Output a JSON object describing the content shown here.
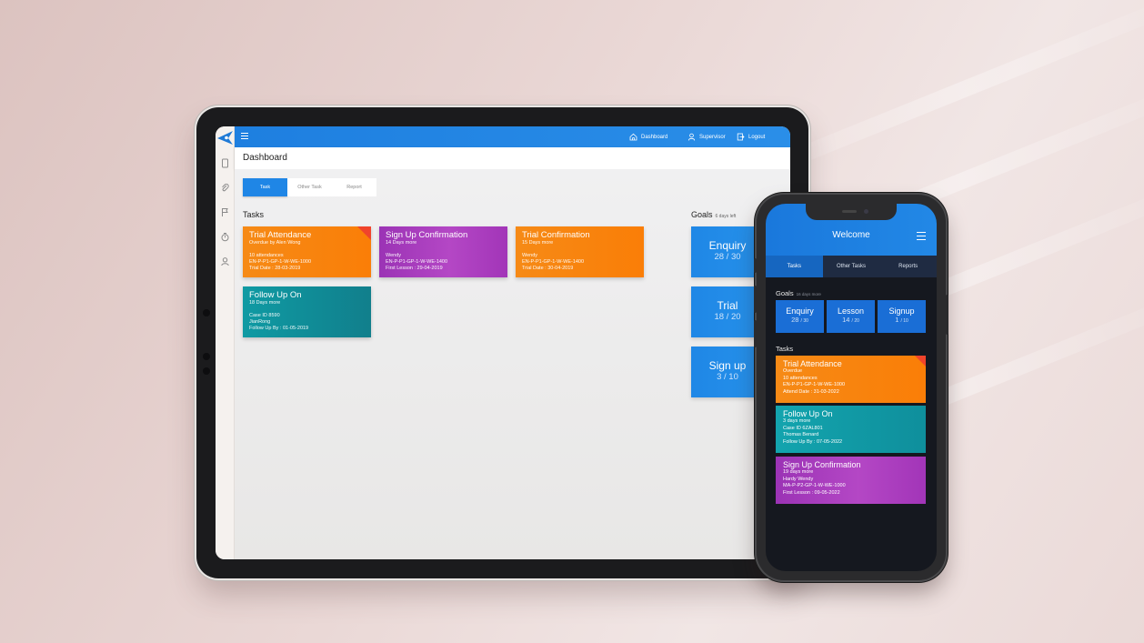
{
  "tablet": {
    "header": {
      "nav": [
        {
          "label": "Dashboard",
          "icon": "home-icon"
        },
        {
          "label": "Supervisor",
          "icon": "user-icon"
        },
        {
          "label": "Logout",
          "icon": "logout-icon"
        }
      ]
    },
    "sidebar": {
      "icons": [
        "tablet-icon",
        "paperclip-icon",
        "flag-icon",
        "timer-icon",
        "user-icon"
      ]
    },
    "page_title": "Dashboard",
    "tabs": [
      {
        "label": "Task",
        "active": true
      },
      {
        "label": "Other Task",
        "active": false
      },
      {
        "label": "Report",
        "active": false
      }
    ],
    "tasks_heading": "Tasks",
    "tasks": [
      {
        "title": "Trial Attendance",
        "subtitle": "Overdue by Alen Wong",
        "lines": [
          "10 attendances",
          "EN-P-P1-GP-1-W-WE-1000",
          "Trial Date : 28-03-2019"
        ],
        "color": "orange",
        "flag": true
      },
      {
        "title": "Sign Up Confirmation",
        "subtitle": "14 Days more",
        "lines": [
          "Wendy",
          "EN-P-P1-GP-1-W-WE-1400",
          "First Lesson : 29-04-2019"
        ],
        "color": "purple",
        "flag": false
      },
      {
        "title": "Trial Confirmation",
        "subtitle": "15 Days more",
        "lines": [
          "Wendy",
          "EN-P-P1-GP-1-W-WE-1400",
          "Trial Date : 30-04-2019"
        ],
        "color": "orange",
        "flag": false
      },
      {
        "title": "Follow Up On",
        "subtitle": "18 Days more",
        "lines": [
          "Case ID 8590",
          "JianRong",
          "Follow Up By : 01-05-2019"
        ],
        "color": "teal",
        "flag": false
      }
    ],
    "goals_heading": "Goals",
    "goals_note": "6 days left",
    "goals": [
      {
        "name": "Enquiry",
        "value": "28 / 30"
      },
      {
        "name": "Trial",
        "value": "18 / 20"
      },
      {
        "name": "Sign up",
        "value": "3 / 10"
      }
    ]
  },
  "phone": {
    "title": "Welcome",
    "tabs": [
      {
        "label": "Tasks",
        "active": true
      },
      {
        "label": "Other Tasks",
        "active": false
      },
      {
        "label": "Reports",
        "active": false
      }
    ],
    "goals_heading": "Goals",
    "goals_note": "16 days more",
    "goals": [
      {
        "name": "Enquiry",
        "current": "28",
        "total": "/ 30"
      },
      {
        "name": "Lesson",
        "current": "14",
        "total": "/ 20"
      },
      {
        "name": "Signup",
        "current": "1",
        "total": "/ 10"
      }
    ],
    "tasks_heading": "Tasks",
    "tasks": [
      {
        "title": "Trial Attendance",
        "subtitle": "Overdue",
        "lines": [
          "10 attendances",
          "EN-P-P1-GP-1-W-WE-1000",
          "Attend Date : 31-03-2022"
        ],
        "color": "orange",
        "flag": true
      },
      {
        "title": "Follow Up On",
        "subtitle": "3 days more",
        "lines": [
          "Case ID 6ZAL801",
          "Thomas Benard",
          "Follow Up By : 07-05-2022"
        ],
        "color": "teal",
        "flag": false
      },
      {
        "title": "Sign Up Confirmation",
        "subtitle": "19 days more",
        "lines": [
          "Hardy Wendy",
          "MA-P-P2-GP-1-W-WE-1000",
          "First Lesson : 09-05-2022"
        ],
        "color": "purple",
        "flag": false
      }
    ]
  },
  "colors": {
    "brand_blue": "#1f86e6",
    "orange": "#f68a16",
    "purple": "#a235b8",
    "teal": "#0f9aa3",
    "overdue_flag": "#f0442b",
    "phone_bg": "#15181f"
  }
}
